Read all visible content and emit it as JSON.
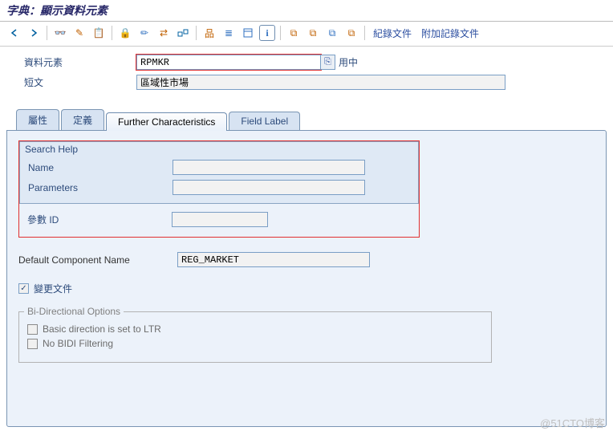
{
  "window": {
    "title": "字典：顯示資料元素"
  },
  "toolbar": {
    "links": {
      "log_docs": "紀錄文件",
      "add_log_docs": "附加記錄文件"
    }
  },
  "header": {
    "data_element_label": "資料元素",
    "data_element_value": "RPMKR",
    "status": "用中",
    "short_text_label": "短文",
    "short_text_value": "區域性市場"
  },
  "tabs": {
    "t1": "屬性",
    "t2": "定義",
    "t3": "Further Characteristics",
    "t4": "Field Label"
  },
  "search_help": {
    "title": "Search Help",
    "name_label": "Name",
    "name_value": "",
    "param_label": "Parameters",
    "param_value": ""
  },
  "param_id": {
    "label": "參數 ID",
    "value": ""
  },
  "default_comp": {
    "label": "Default Component Name",
    "value": "REG_MARKET"
  },
  "change_doc": {
    "label": "變更文件"
  },
  "bidi": {
    "title": "Bi-Directional Options",
    "opt1": "Basic direction is set to LTR",
    "opt2": "No BIDI Filtering"
  },
  "watermark": "@51CTO博客"
}
